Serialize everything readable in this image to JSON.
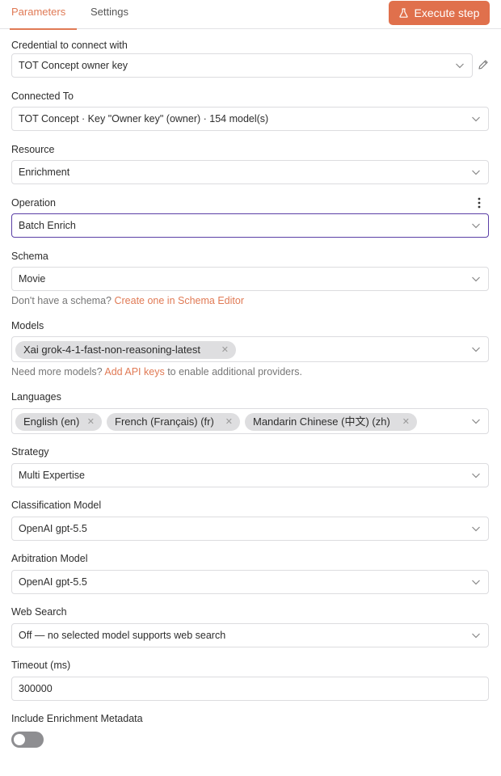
{
  "tabs": [
    {
      "label": "Parameters",
      "active": true
    },
    {
      "label": "Settings",
      "active": false
    }
  ],
  "execute_button": {
    "label": "Execute step",
    "icon": "flask-icon"
  },
  "colors": {
    "accent": "#e0704c",
    "focus_border": "#5b3fa6"
  },
  "credential": {
    "label": "Credential to connect with",
    "value": "TOT Concept owner key",
    "edit_icon": "pencil-icon"
  },
  "connected_to": {
    "label": "Connected To",
    "value": "TOT Concept · Key \"Owner  key\" (owner) · 154 model(s)"
  },
  "resource": {
    "label": "Resource",
    "value": "Enrichment"
  },
  "operation": {
    "label": "Operation",
    "value": "Batch Enrich",
    "menu_icon": "kebab-icon"
  },
  "schema": {
    "label": "Schema",
    "value": "Movie",
    "hint_prefix": "Don't have a schema?",
    "hint_link": "Create one in Schema Editor"
  },
  "models": {
    "label": "Models",
    "chips": [
      "Xai grok-4-1-fast-non-reasoning-latest"
    ],
    "hint_prefix": "Need more models?",
    "hint_link": "Add API keys",
    "hint_suffix": "to enable additional providers."
  },
  "languages": {
    "label": "Languages",
    "chips": [
      "English (en)",
      "French (Français) (fr)",
      "Mandarin Chinese (中文) (zh)"
    ]
  },
  "strategy": {
    "label": "Strategy",
    "value": "Multi Expertise"
  },
  "classification_model": {
    "label": "Classification Model",
    "value": "OpenAI gpt-5.5"
  },
  "arbitration_model": {
    "label": "Arbitration Model",
    "value": "OpenAI gpt-5.5"
  },
  "web_search": {
    "label": "Web Search",
    "value": "Off — no selected model supports web search"
  },
  "timeout": {
    "label": "Timeout (ms)",
    "value": "300000"
  },
  "include_metadata": {
    "label": "Include Enrichment Metadata",
    "enabled": false
  }
}
